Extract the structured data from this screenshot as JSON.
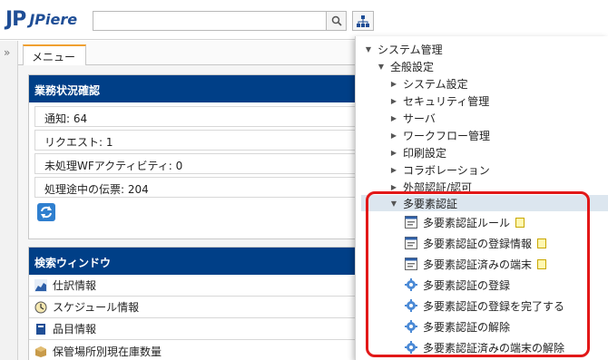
{
  "header": {
    "logo_mark": "JP",
    "logo_word": "JPiere",
    "search_value": ""
  },
  "tabs": {
    "menu": "メニュー"
  },
  "business_status": {
    "title": "業務状況確認",
    "rows": [
      "通知: 64",
      "リクエスト: 1",
      "未処理WFアクティビティ: 0",
      "処理途中の伝票: 204"
    ]
  },
  "search_window": {
    "title": "検索ウィンドウ",
    "items": [
      {
        "label": "仕訳情報",
        "icon": "chart-icon"
      },
      {
        "label": "スケジュール情報",
        "icon": "clock-icon"
      },
      {
        "label": "品目情報",
        "icon": "book-icon"
      },
      {
        "label": "保管場所別現在庫数量",
        "icon": "box-icon"
      }
    ]
  },
  "tree": {
    "root": "システム管理",
    "general": "全般設定",
    "children": [
      "システム設定",
      "セキュリティ管理",
      "サーバ",
      "ワークフロー管理",
      "印刷設定",
      "コラボレーション",
      "外部認証/認可"
    ],
    "mfa": "多要素認証",
    "mfa_windows": [
      "多要素認証ルール",
      "多要素認証の登録情報",
      "多要素認証済みの端末"
    ],
    "mfa_processes": [
      "多要素認証の登録",
      "多要素認証の登録を完了する",
      "多要素認証の解除",
      "多要素認証済みの端末の解除"
    ]
  },
  "colors": {
    "panel_header": "#003f87",
    "highlight": "#e21818",
    "tab_accent": "#f0a030"
  }
}
